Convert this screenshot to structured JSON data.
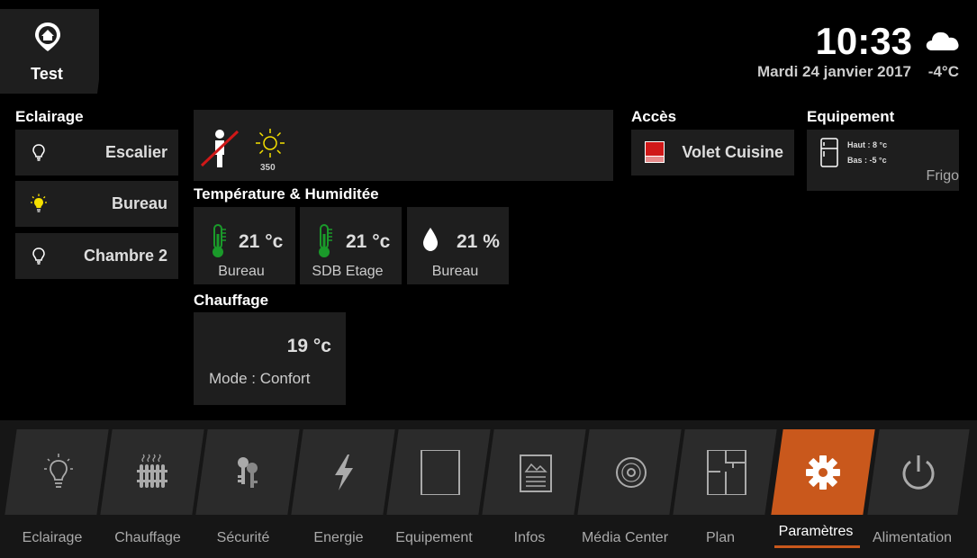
{
  "location": {
    "name": "Test"
  },
  "clock": {
    "time": "10:33",
    "date": "Mardi 24 janvier 2017",
    "temperature": "-4°C",
    "weather_icon": "cloud-icon"
  },
  "eclairage": {
    "title": "Eclairage",
    "items": [
      {
        "label": "Escalier",
        "state": "off"
      },
      {
        "label": "Bureau",
        "state": "on"
      },
      {
        "label": "Chambre 2",
        "state": "off"
      }
    ]
  },
  "presence": {
    "luminosity": "350"
  },
  "temperature": {
    "title": "Température & Humiditée",
    "sensors": [
      {
        "value": "21 °c",
        "label": "Bureau",
        "icon": "thermometer-icon"
      },
      {
        "value": "21 °c",
        "label": "SDB Etage",
        "icon": "thermometer-icon"
      },
      {
        "value": "21 %",
        "label": "Bureau",
        "icon": "drop-icon"
      }
    ]
  },
  "chauffage": {
    "title": "Chauffage",
    "value": "19 °c",
    "mode": "Mode : Confort"
  },
  "acces": {
    "title": "Accès",
    "item": "Volet Cuisine"
  },
  "equipement": {
    "title": "Equipement",
    "haut": "Haut : 8 °c",
    "bas": "Bas : -5 °c",
    "name": "Frigo"
  },
  "nav": [
    {
      "label": "Eclairage",
      "icon": "bulb-icon"
    },
    {
      "label": "Chauffage",
      "icon": "radiator-icon"
    },
    {
      "label": "Sécurité",
      "icon": "keys-icon"
    },
    {
      "label": "Energie",
      "icon": "lightning-icon"
    },
    {
      "label": "Equipement",
      "icon": "fridge-icon"
    },
    {
      "label": "Infos",
      "icon": "newspaper-icon"
    },
    {
      "label": "Média Center",
      "icon": "disc-icon"
    },
    {
      "label": "Plan",
      "icon": "floorplan-icon"
    },
    {
      "label": "Paramètres",
      "icon": "gear-icon",
      "active": true
    },
    {
      "label": "Alimentation",
      "icon": "power-icon"
    }
  ],
  "colors": {
    "accent": "#c9581c",
    "thermometer": "#1a9a2a",
    "bulb_on": "#f5e000",
    "volet": "#d01818"
  }
}
